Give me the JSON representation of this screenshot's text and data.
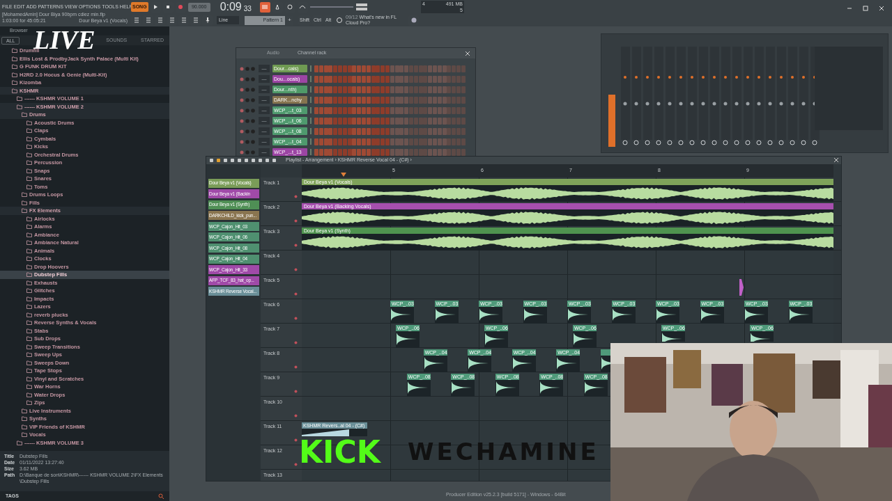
{
  "menu": [
    "FILE",
    "EDIT",
    "ADD",
    "PATTERNS",
    "VIEW",
    "OPTIONS",
    "TOOLS",
    "HELP"
  ],
  "transport": {
    "mode": "SONG",
    "song_mode": true,
    "tempo": "90.000",
    "time": "0:09",
    "time_sub": "33",
    "cpu": "4",
    "memory": "491 MB",
    "polyphony": "5"
  },
  "hint": {
    "file": "[MohamedAmin] Dour Biya 90bpm cdiez min.flp",
    "time": "1:03:00 for 45:05:21",
    "channel": "Dour Beya v1 (Vocals)"
  },
  "toolbar": {
    "snap": "Line",
    "pattern": "Pattern 1",
    "add": "+",
    "keys": [
      "Shift",
      "Ctrl",
      "Alt"
    ],
    "news_date": "09/12",
    "news": "What's new in FL Cloud Pro?"
  },
  "overlay": {
    "live": "LIVE",
    "platform": "KICK",
    "channel_name": "WECHAMINE"
  },
  "browser": {
    "title": "Browser",
    "tabs": [
      {
        "label": "ALL",
        "selected": true
      },
      {
        "label": "SOUNDS",
        "selected": false
      },
      {
        "label": "STARRED",
        "selected": false
      }
    ],
    "tree": [
      {
        "label": "Drumfill",
        "selected": false
      },
      {
        "label": "Ellis Lost & ProdbyJack Synth Palace (Multi Kit)",
        "selected": false
      },
      {
        "label": "G FUNK DRUM KIT",
        "selected": false
      },
      {
        "label": "H2RD 2.0 Hocus & Genie (Multi-Kit)",
        "selected": false
      },
      {
        "label": "Kizomba",
        "selected": false
      },
      {
        "label": "KSHMR",
        "selected": false,
        "children": [
          {
            "label": "------ KSHMR VOLUME 1",
            "selected": false
          },
          {
            "label": "------ KSHMR VOLUME 2",
            "selected": false,
            "children": [
              {
                "label": "Drums",
                "selected": false,
                "children": [
                  {
                    "label": "Acoustic Drums",
                    "selected": false
                  },
                  {
                    "label": "Claps",
                    "selected": false
                  },
                  {
                    "label": "Cymbals",
                    "selected": false
                  },
                  {
                    "label": "Kicks",
                    "selected": false
                  },
                  {
                    "label": "Orchestral Drums",
                    "selected": false
                  },
                  {
                    "label": "Percussion",
                    "selected": false
                  },
                  {
                    "label": "Snaps",
                    "selected": false
                  },
                  {
                    "label": "Snares",
                    "selected": false
                  },
                  {
                    "label": "Toms",
                    "selected": false
                  }
                ]
              },
              {
                "label": "Drums Loops",
                "selected": false
              },
              {
                "label": "Fills",
                "selected": false
              },
              {
                "label": "FX Elements",
                "selected": false,
                "children": [
                  {
                    "label": "Airlocks",
                    "selected": false
                  },
                  {
                    "label": "Alarms",
                    "selected": false
                  },
                  {
                    "label": "Ambiance",
                    "selected": false
                  },
                  {
                    "label": "Ambiance Natural",
                    "selected": false
                  },
                  {
                    "label": "Animals",
                    "selected": false
                  },
                  {
                    "label": "Clocks",
                    "selected": false
                  },
                  {
                    "label": "Drop Hoovers",
                    "selected": false
                  },
                  {
                    "label": "Dubstep Fills",
                    "selected": true
                  },
                  {
                    "label": "Exhausts",
                    "selected": false
                  },
                  {
                    "label": "Glitches",
                    "selected": false
                  },
                  {
                    "label": "Impacts",
                    "selected": false
                  },
                  {
                    "label": "Lazers",
                    "selected": false
                  },
                  {
                    "label": "reverb plucks",
                    "selected": false
                  },
                  {
                    "label": "Reverse Synths & Vocals",
                    "selected": false
                  },
                  {
                    "label": "Stabs",
                    "selected": false
                  },
                  {
                    "label": "Sub Drops",
                    "selected": false
                  },
                  {
                    "label": "Sweep Transitions",
                    "selected": false
                  },
                  {
                    "label": "Sweep Ups",
                    "selected": false
                  },
                  {
                    "label": "Sweeps Down",
                    "selected": false
                  },
                  {
                    "label": "Tape Stops",
                    "selected": false
                  },
                  {
                    "label": "Vinyl and Scratches",
                    "selected": false
                  },
                  {
                    "label": "War Horns",
                    "selected": false
                  },
                  {
                    "label": "Water Drops",
                    "selected": false
                  },
                  {
                    "label": "Zips",
                    "selected": false
                  }
                ]
              },
              {
                "label": "Live Instruments",
                "selected": false
              },
              {
                "label": "Synths",
                "selected": false
              },
              {
                "label": "VIP Friends of KSHMR",
                "selected": false
              },
              {
                "label": "Vocals",
                "selected": false
              }
            ]
          },
          {
            "label": "------ KSHMR VOLUME 3",
            "selected": false
          }
        ]
      }
    ],
    "info": [
      {
        "key": "Title",
        "value": "Dubstep Fills"
      },
      {
        "key": "Date",
        "value": "01/11/2022 13:27:40"
      },
      {
        "key": "Size",
        "value": "3.62 MB"
      },
      {
        "key": "Path",
        "value": "D:\\Banque de son\\KSHMR\\------ KSHMR VOLUME 2\\FX Elements\\Dubstep Fills"
      }
    ],
    "tags_label": "TAGS"
  },
  "channel_rack": {
    "filter": "Audio",
    "title": "Channel rack",
    "channels": [
      {
        "name": "Dour...cals)",
        "insert": "—",
        "color": "#6f9a52"
      },
      {
        "name": "Dou...ocals)",
        "insert": "—",
        "color": "#9c45a4"
      },
      {
        "name": "Dour...nth)",
        "insert": "—",
        "color": "#4f9a68"
      },
      {
        "name": "DARK...nchy",
        "insert": "—",
        "color": "#86744f"
      },
      {
        "name": "WCP_...t_03",
        "insert": "—",
        "color": "#4f9a6e"
      },
      {
        "name": "WCP_...t_06",
        "insert": "—",
        "color": "#4f9a6e"
      },
      {
        "name": "WCP_...t_08",
        "insert": "—",
        "color": "#4f9a6e"
      },
      {
        "name": "WCP_...t_04",
        "insert": "—",
        "color": "#4f9a6e"
      },
      {
        "name": "WCP_...t_13",
        "insert": "—",
        "color": "#9c45a4"
      }
    ]
  },
  "playlist": {
    "title": "Playlist - Arrangement › KSHMR Reverse Vocal 04 - (C#) ›",
    "picker": [
      {
        "name": "Dour Beya v1 (Vocals)",
        "color": "#7a9c58"
      },
      {
        "name": "Dour Beya v1 (Backin",
        "color": "#a04aa8"
      },
      {
        "name": "Dour Beya v1 (Synth)",
        "color": "#4f8f55"
      },
      {
        "name": "DARKCHILD_kick_pun...",
        "color": "#8a7550"
      },
      {
        "name": "WCP_Cajon_Hit_03",
        "color": "#4f9070"
      },
      {
        "name": "WCP_Cajon_Hit_06",
        "color": "#4f9070"
      },
      {
        "name": "WCP_Cajon_Hit_08",
        "color": "#4f9070"
      },
      {
        "name": "WCP_Cajon_Hit_04",
        "color": "#4f9070"
      },
      {
        "name": "WCP_Cajon_Hit_33",
        "color": "#a04aa8"
      },
      {
        "name": "AFP_TCF_83_hat_op...",
        "color": "#a04aa8"
      },
      {
        "name": "KSHMR Reverse Vocal...",
        "color": "#6a8f98"
      }
    ],
    "ruler": [
      {
        "bar": "5"
      },
      {
        "bar": "6"
      },
      {
        "bar": "7"
      },
      {
        "bar": "8"
      },
      {
        "bar": "9"
      }
    ],
    "tracks": [
      {
        "name": "Track 1",
        "clips": [
          {
            "kind": "audio",
            "label": "Dour Beya v1 (Vocals)",
            "color": "#7fa35a"
          }
        ]
      },
      {
        "name": "Track 2",
        "clips": [
          {
            "kind": "audio",
            "label": "Dour Beya v1 (Backing Vocals)",
            "color": "#a64fae"
          }
        ]
      },
      {
        "name": "Track 3",
        "clips": [
          {
            "kind": "audio",
            "label": "Dour Beya v1 (Synth)",
            "color": "#4f934f"
          }
        ]
      },
      {
        "name": "Track 4"
      },
      {
        "name": "Track 5",
        "clips": [
          {
            "kind": "slice",
            "color": "#c060c8"
          }
        ]
      },
      {
        "name": "Track 6",
        "clips": [
          {
            "kind": "hit",
            "label": "WCP_..03",
            "color": "#4f9a7a"
          },
          {
            "kind": "hit",
            "label": "WCP_..03",
            "color": "#4f9a7a"
          },
          {
            "kind": "hit",
            "label": "WCP_..03",
            "color": "#4f9a7a"
          },
          {
            "kind": "hit",
            "label": "WCP_..03",
            "color": "#4f9a7a"
          },
          {
            "kind": "hit",
            "label": "WCP_..03",
            "color": "#4f9a7a"
          },
          {
            "kind": "hit",
            "label": "WCP_..03",
            "color": "#4f9a7a"
          },
          {
            "kind": "hit",
            "label": "WCP_..03",
            "color": "#4f9a7a"
          },
          {
            "kind": "hit",
            "label": "WCP_..03",
            "color": "#4f9a7a"
          },
          {
            "kind": "hit",
            "label": "WCP_..03",
            "color": "#4f9a7a"
          },
          {
            "kind": "hit",
            "label": "WCP_..03",
            "color": "#4f9a7a"
          }
        ]
      },
      {
        "name": "Track 7",
        "clips": [
          {
            "kind": "hit",
            "label": "WCP_..06",
            "color": "#4f9a7a"
          },
          {
            "kind": "hit",
            "label": "WCP_..06",
            "color": "#4f9a7a"
          },
          {
            "kind": "hit",
            "label": "WCP_..06",
            "color": "#4f9a7a"
          },
          {
            "kind": "hit",
            "label": "WCP_..06",
            "color": "#4f9a7a"
          },
          {
            "kind": "hit",
            "label": "WCP_..06",
            "color": "#4f9a7a"
          }
        ]
      },
      {
        "name": "Track 8",
        "clips": [
          {
            "kind": "hit",
            "label": "WCP_..04",
            "color": "#4f9a7a"
          },
          {
            "kind": "hit",
            "label": "WCP_..04",
            "color": "#4f9a7a"
          },
          {
            "kind": "hit",
            "label": "WCP_..04",
            "color": "#4f9a7a"
          },
          {
            "kind": "hit",
            "label": "WCP_..04",
            "color": "#4f9a7a"
          },
          {
            "kind": "hit",
            "color": "#4f9a7a"
          }
        ]
      },
      {
        "name": "Track 9",
        "clips": [
          {
            "kind": "hit",
            "label": "WCP_..08",
            "color": "#4f9a7a"
          },
          {
            "kind": "hit",
            "label": "WCP_..08",
            "color": "#4f9a7a"
          },
          {
            "kind": "hit",
            "label": "WCP_..08",
            "color": "#4f9a7a"
          },
          {
            "kind": "hit",
            "label": "WCP_..08",
            "color": "#4f9a7a"
          },
          {
            "kind": "hit",
            "label": "WCP_..08",
            "color": "#4f9a7a"
          }
        ]
      },
      {
        "name": "Track 10"
      },
      {
        "name": "Track 11",
        "clips": [
          {
            "kind": "reverse",
            "label": "KSHMR Revers..al 04 - (C#)",
            "color": "#6a8f98"
          }
        ]
      },
      {
        "name": "Track 12"
      },
      {
        "name": "Track 13"
      }
    ]
  },
  "version": "Producer Edition v25.2.3 [build 5171] - Windows - 64Bit"
}
